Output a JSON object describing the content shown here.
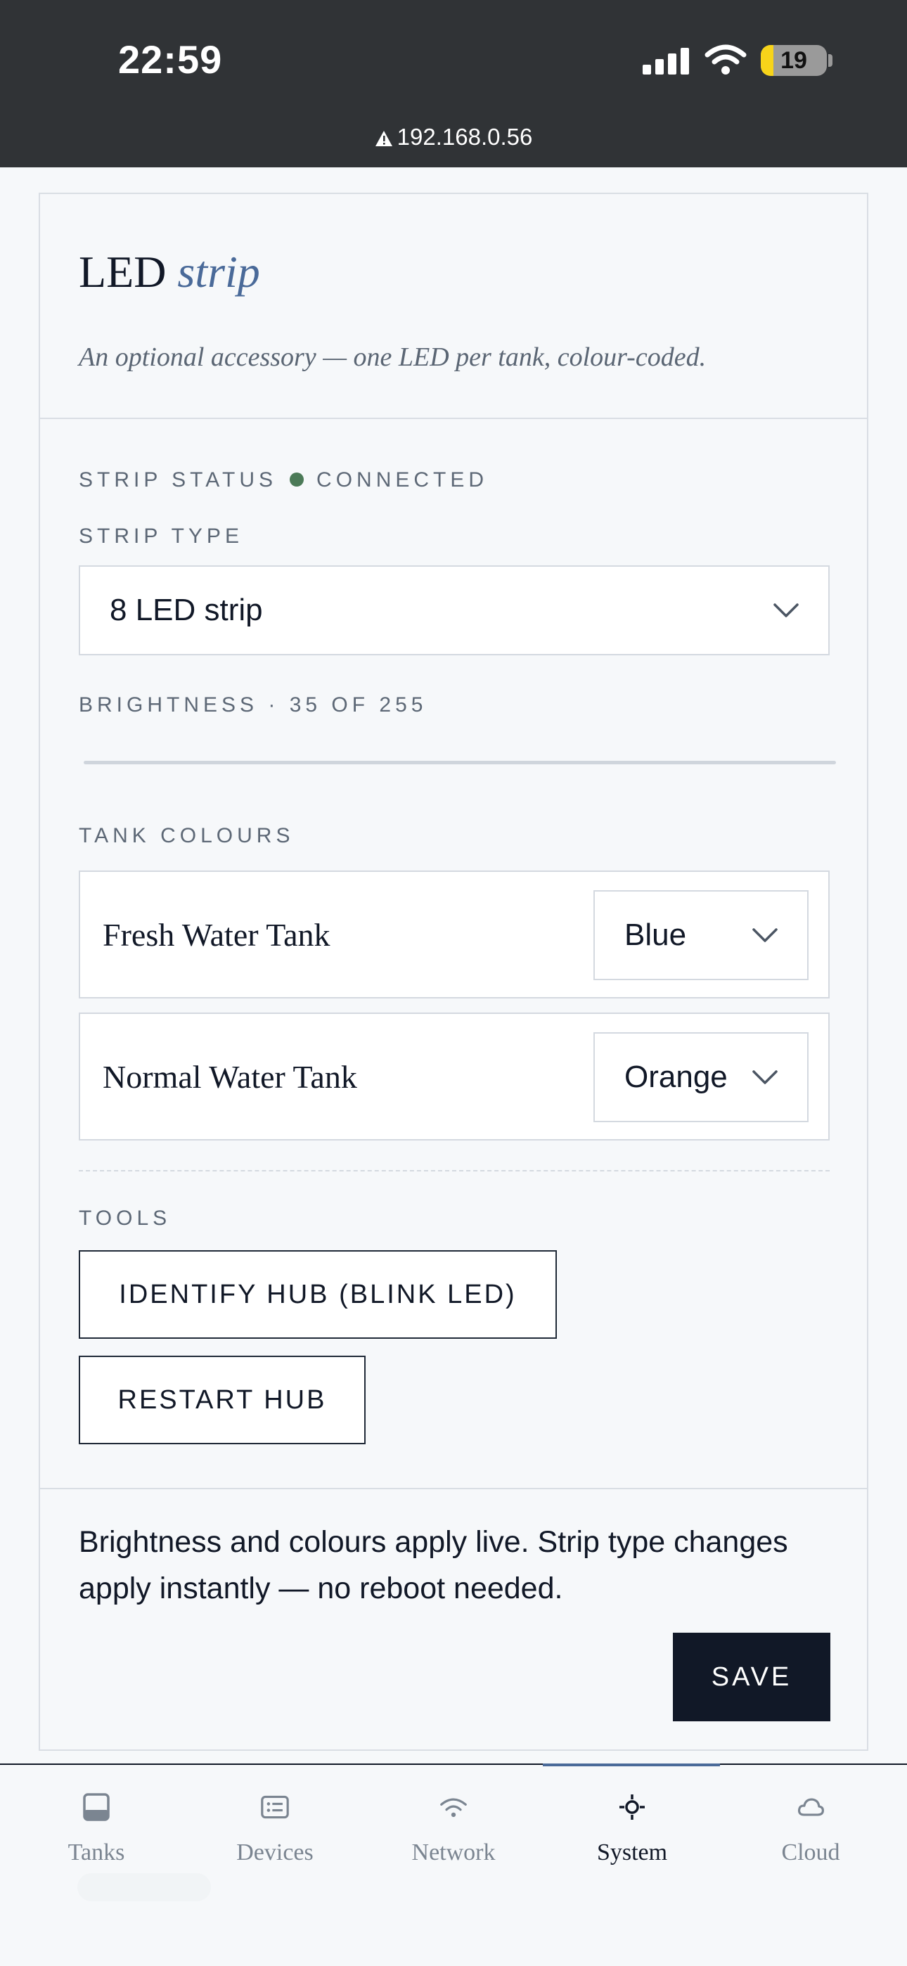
{
  "status_bar": {
    "time": "22:59",
    "battery_level": "19",
    "battery_fraction": 0.19,
    "url": "192.168.0.56",
    "icons": [
      "warning-icon",
      "signal-icon",
      "wifi-icon",
      "battery-icon"
    ]
  },
  "colors": {
    "accent": "#4a6a99",
    "dark": "#111827",
    "connected": "#4b7a57",
    "statusbar_bg": "#303336"
  },
  "header": {
    "title_main": "LED",
    "title_em": "strip",
    "subtitle": "An optional accessory — one LED per tank, colour-coded."
  },
  "strip_status": {
    "label": "STRIP STATUS",
    "value": "CONNECTED"
  },
  "strip_type": {
    "label": "STRIP TYPE",
    "value": "8 LED strip"
  },
  "brightness": {
    "label": "BRIGHTNESS · 35 OF 255",
    "value": 35,
    "max": 255
  },
  "tank_colours": {
    "label": "TANK COLOURS",
    "rows": [
      {
        "name": "Fresh Water Tank",
        "colour": "Blue"
      },
      {
        "name": "Normal Water Tank",
        "colour": "Orange"
      }
    ]
  },
  "tools": {
    "label": "TOOLS",
    "identify_label": "IDENTIFY HUB (BLINK LED)",
    "restart_label": "RESTART HUB"
  },
  "footer": {
    "note": "Brightness and colours apply live. Strip type changes apply instantly — no reboot needed.",
    "save_label": "SAVE"
  },
  "tabs": [
    {
      "label": "Tanks",
      "icon": "tank-icon",
      "active": false
    },
    {
      "label": "Devices",
      "icon": "devices-icon",
      "active": false
    },
    {
      "label": "Network",
      "icon": "wifi-icon",
      "active": false
    },
    {
      "label": "System",
      "icon": "crosshair-icon",
      "active": true
    },
    {
      "label": "Cloud",
      "icon": "cloud-icon",
      "active": false
    }
  ]
}
